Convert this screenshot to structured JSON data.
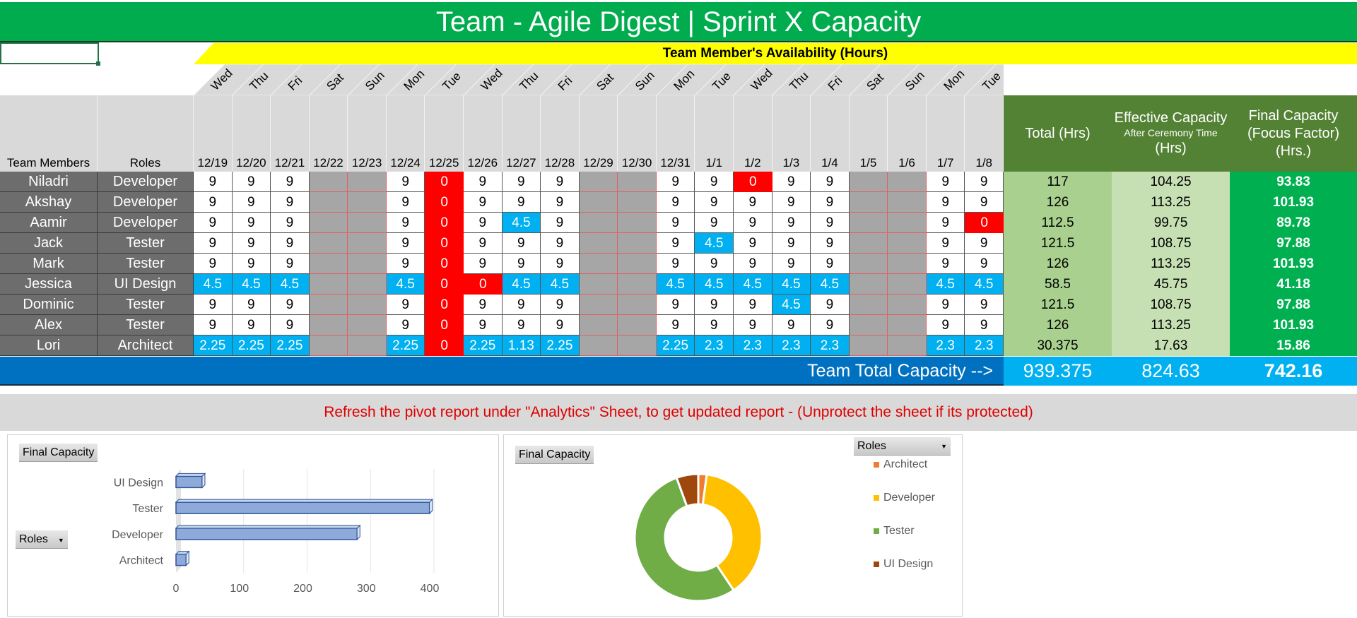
{
  "title": "Team - Agile Digest | Sprint X Capacity",
  "availability_header": "Team Member's Availability (Hours)",
  "columns": {
    "members": "Team Members",
    "roles": "Roles",
    "total": "Total (Hrs)",
    "effective_line1": "Effective Capacity",
    "effective_line2": "After Ceremony Time",
    "effective_line3": "(Hrs)",
    "final_line1": "Final Capacity",
    "final_line2": "(Focus Factor)",
    "final_line3": "(Hrs.)"
  },
  "days": [
    {
      "day": "Wed",
      "date": "12/19"
    },
    {
      "day": "Thu",
      "date": "12/20"
    },
    {
      "day": "Fri",
      "date": "12/21"
    },
    {
      "day": "Sat",
      "date": "12/22"
    },
    {
      "day": "Sun",
      "date": "12/23"
    },
    {
      "day": "Mon",
      "date": "12/24"
    },
    {
      "day": "Tue",
      "date": "12/25"
    },
    {
      "day": "Wed",
      "date": "12/26"
    },
    {
      "day": "Thu",
      "date": "12/27"
    },
    {
      "day": "Fri",
      "date": "12/28"
    },
    {
      "day": "Sat",
      "date": "12/29"
    },
    {
      "day": "Sun",
      "date": "12/30"
    },
    {
      "day": "Mon",
      "date": "12/31"
    },
    {
      "day": "Tue",
      "date": "1/1"
    },
    {
      "day": "Wed",
      "date": "1/2"
    },
    {
      "day": "Thu",
      "date": "1/3"
    },
    {
      "day": "Fri",
      "date": "1/4"
    },
    {
      "day": "Sat",
      "date": "1/5"
    },
    {
      "day": "Sun",
      "date": "1/6"
    },
    {
      "day": "Mon",
      "date": "1/7"
    },
    {
      "day": "Tue",
      "date": "1/8"
    }
  ],
  "members": [
    {
      "name": "Niladri",
      "role": "Developer",
      "hours": [
        "9",
        "9",
        "9",
        "",
        "",
        "9",
        "0",
        "9",
        "9",
        "9",
        "",
        "",
        "9",
        "9",
        "0",
        "9",
        "9",
        "",
        "",
        "9",
        "9"
      ],
      "total": "117",
      "effective": "104.25",
      "final": "93.83"
    },
    {
      "name": "Akshay",
      "role": "Developer",
      "hours": [
        "9",
        "9",
        "9",
        "",
        "",
        "9",
        "0",
        "9",
        "9",
        "9",
        "",
        "",
        "9",
        "9",
        "9",
        "9",
        "9",
        "",
        "",
        "9",
        "9"
      ],
      "total": "126",
      "effective": "113.25",
      "final": "101.93"
    },
    {
      "name": "Aamir",
      "role": "Developer",
      "hours": [
        "9",
        "9",
        "9",
        "",
        "",
        "9",
        "0",
        "9",
        "4.5",
        "9",
        "",
        "",
        "9",
        "9",
        "9",
        "9",
        "9",
        "",
        "",
        "9",
        "0"
      ],
      "total": "112.5",
      "effective": "99.75",
      "final": "89.78"
    },
    {
      "name": "Jack",
      "role": "Tester",
      "hours": [
        "9",
        "9",
        "9",
        "",
        "",
        "9",
        "0",
        "9",
        "9",
        "9",
        "",
        "",
        "9",
        "4.5",
        "9",
        "9",
        "9",
        "",
        "",
        "9",
        "9"
      ],
      "total": "121.5",
      "effective": "108.75",
      "final": "97.88"
    },
    {
      "name": "Mark",
      "role": "Tester",
      "hours": [
        "9",
        "9",
        "9",
        "",
        "",
        "9",
        "0",
        "9",
        "9",
        "9",
        "",
        "",
        "9",
        "9",
        "9",
        "9",
        "9",
        "",
        "",
        "9",
        "9"
      ],
      "total": "126",
      "effective": "113.25",
      "final": "101.93"
    },
    {
      "name": "Jessica",
      "role": "UI Design",
      "hours": [
        "4.5",
        "4.5",
        "4.5",
        "",
        "",
        "4.5",
        "0",
        "0",
        "4.5",
        "4.5",
        "",
        "",
        "4.5",
        "4.5",
        "4.5",
        "4.5",
        "4.5",
        "",
        "",
        "4.5",
        "4.5"
      ],
      "total": "58.5",
      "effective": "45.75",
      "final": "41.18"
    },
    {
      "name": "Dominic",
      "role": "Tester",
      "hours": [
        "9",
        "9",
        "9",
        "",
        "",
        "9",
        "0",
        "9",
        "9",
        "9",
        "",
        "",
        "9",
        "9",
        "9",
        "4.5",
        "9",
        "",
        "",
        "9",
        "9"
      ],
      "total": "121.5",
      "effective": "108.75",
      "final": "97.88"
    },
    {
      "name": "Alex",
      "role": "Tester",
      "hours": [
        "9",
        "9",
        "9",
        "",
        "",
        "9",
        "0",
        "9",
        "9",
        "9",
        "",
        "",
        "9",
        "9",
        "9",
        "9",
        "9",
        "",
        "",
        "9",
        "9"
      ],
      "total": "126",
      "effective": "113.25",
      "final": "101.93"
    },
    {
      "name": "Lori",
      "role": "Architect",
      "hours": [
        "2.25",
        "2.25",
        "2.25",
        "",
        "",
        "2.25",
        "0",
        "2.25",
        "1.13",
        "2.25",
        "",
        "",
        "2.25",
        "2.3",
        "2.3",
        "2.3",
        "2.3",
        "",
        "",
        "2.3",
        "2.3"
      ],
      "total": "30.375",
      "effective": "17.63",
      "final": "15.86"
    }
  ],
  "team_total": {
    "label": "Team Total Capacity -->",
    "total": "939.375",
    "effective": "824.63",
    "final": "742.16"
  },
  "message": "Refresh the pivot report under \"Analytics\" Sheet, to get updated report - (Unprotect the sheet if its protected)",
  "colors": {
    "title_green": "#00AC4E",
    "header_yellow": "#FFFF00",
    "name_grey": "#6D6D6D",
    "partial_blue": "#00B0F0",
    "off_red": "#FF0000",
    "weekend_grey": "#A6A6A6",
    "total_row_blue": "#0070C0",
    "final_green": "#00B050"
  },
  "chart_data": [
    {
      "type": "bar",
      "orientation": "horizontal",
      "title": "Final Capacity",
      "field_button": "Roles",
      "categories": [
        "UI Design",
        "Tester",
        "Developer",
        "Architect"
      ],
      "values": [
        41.18,
        399.62,
        285.54,
        15.86
      ],
      "xlim": [
        0,
        400
      ],
      "xticks": [
        "0",
        "100",
        "200",
        "300",
        "400"
      ],
      "grid": true,
      "legend": "none"
    },
    {
      "type": "pie",
      "variant": "doughnut",
      "title": "Final Capacity",
      "field_button": "Roles",
      "categories": [
        "Architect",
        "Developer",
        "Tester",
        "UI Design"
      ],
      "values": [
        15.86,
        285.54,
        399.62,
        41.18
      ],
      "colors": [
        "#ED7D31",
        "#FFC000",
        "#70AD47",
        "#9E480E"
      ],
      "legend": "right"
    }
  ]
}
